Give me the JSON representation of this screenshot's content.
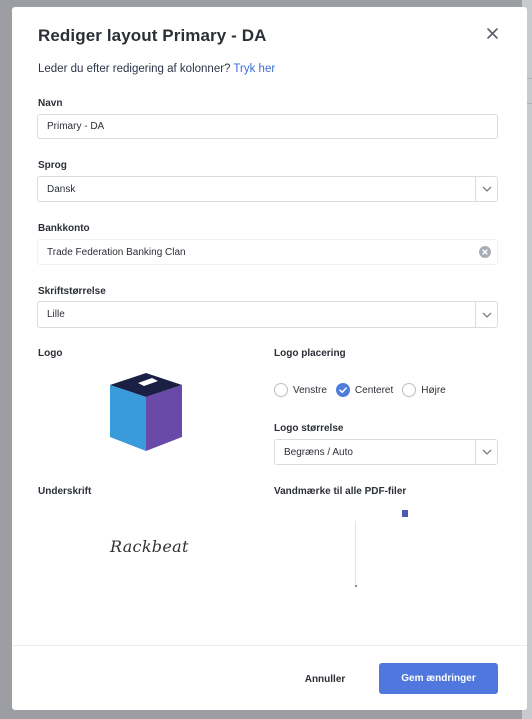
{
  "dialog": {
    "title": "Rediger layout Primary - DA",
    "hint_text": "Leder du efter redigering af kolonner? ",
    "hint_link": "Tryk her"
  },
  "fields": {
    "name": {
      "label": "Navn",
      "value": "Primary - DA"
    },
    "language": {
      "label": "Sprog",
      "value": "Dansk"
    },
    "bank_account": {
      "label": "Bankkonto",
      "value": "Trade Federation Banking Clan"
    },
    "font_size": {
      "label": "Skriftstørrelse",
      "value": "Lille"
    }
  },
  "logo": {
    "label": "Logo",
    "colors": {
      "top": "#1a1f44",
      "left": "#3a9bdc",
      "right": "#6a4aa8"
    }
  },
  "logo_placement": {
    "label": "Logo placering",
    "options": [
      "Venstre",
      "Centeret",
      "Højre"
    ],
    "selected": "Centeret"
  },
  "logo_size": {
    "label": "Logo størrelse",
    "value": "Begræns / Auto"
  },
  "signature": {
    "label": "Underskrift",
    "image_text": "Rackbeat"
  },
  "watermark": {
    "label": "Vandmærke til alle PDF-filer"
  },
  "actions": {
    "cancel": "Annuller",
    "save": "Gem ændringer"
  },
  "colors": {
    "accent": "#4f77dd",
    "link": "#3b6cd6"
  }
}
